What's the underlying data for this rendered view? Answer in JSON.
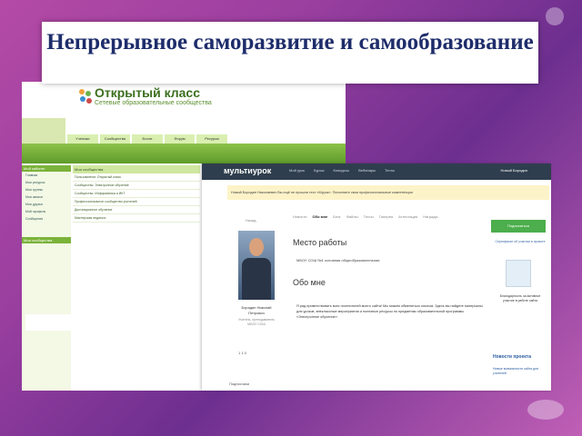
{
  "slide": {
    "title": "Непрерывное саморазвитие и самообразование"
  },
  "left_screenshot": {
    "logo_text": "Открытый класс",
    "logo_sub": "Сетевые образовательные сообщества",
    "nav_items": [
      "Ученики",
      "Сообщества",
      "Блоги",
      "Форум",
      "Ресурсы"
    ],
    "side_head": "Мой кабинет",
    "side_items": [
      "Главная",
      "Мои ресурсы",
      "Мои группы",
      "Мои записи",
      "Мои друзья",
      "Мой профиль",
      "Сообщения"
    ],
    "side_head2": "Мои сообщества",
    "main_head": "Мои сообщества",
    "rows": [
      "Пользователи: Открытый класс",
      "Сообщество: Электронное обучение",
      "Сообщество: Информатика и ИКТ",
      "Профессиональное сообщество учителей",
      "Дистанционное обучение",
      "Мастерская педагога"
    ]
  },
  "right_screenshot": {
    "logo": "мультиурок",
    "menu": [
      "Мой урок",
      "Курсы",
      "Конкурсы",
      "Вебинары",
      "Тесты"
    ],
    "user": "Новый Бородин",
    "notice": "Новый Бородин Николаевич Вы ещё не прошли тест «Мурок». Пополните свои профессиональные компетенции",
    "back": "Назад",
    "tabs": [
      "Новости",
      "Обо мне",
      "Блог",
      "Файлы",
      "Тесты",
      "Галерея",
      "Аттестация",
      "Награды"
    ],
    "active_tab": "Обо мне",
    "h_work": "Место работы",
    "work": "МБОУ СОШ №1 основная общеобразовательная",
    "h_about": "Обо мне",
    "about": "Я рад приветствовать всех посетителей моего сайта! Мы можем обменяться опытом. Здесь вы найдете материалы для уроков, внеклассные мероприятия и полезные ресурсы по предметам образовательной программы «Электронное обучение».",
    "name": "Бородин Николай Петрович",
    "role": "Учитель, преподаватель МБОУ СОШ",
    "stats": "1  1  0",
    "bottom_left": "Подписчики",
    "follow_btn": "Подписаться",
    "side_text": "Сертификат об участии в проекте",
    "side_text2": "Благодарность за активное участие в работе сайта",
    "news_head": "Новости проекта",
    "news": "Новые возможности сайта для учителей"
  },
  "colors": {
    "title": "#1e2d6b",
    "ok_green": "#7bb33a",
    "mu_dark": "#2f3e4e",
    "mu_follow": "#4cae4c"
  }
}
